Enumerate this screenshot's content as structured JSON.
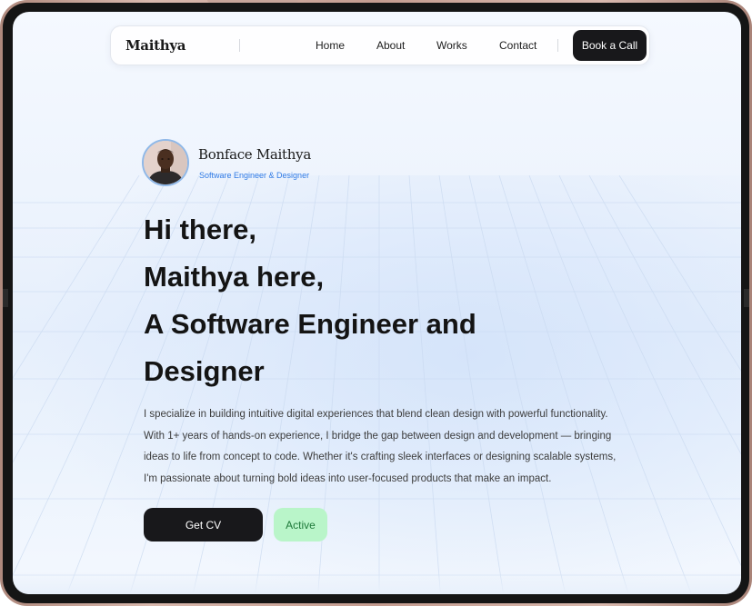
{
  "nav": {
    "brand": "Maithya",
    "links": [
      "Home",
      "About",
      "Works",
      "Contact"
    ],
    "cta_label": "Book a Call"
  },
  "profile": {
    "name": "Bonface Maithya",
    "role": "Software Engineer & Designer"
  },
  "hero": {
    "lines": [
      "Hi there,",
      "Maithya here,",
      "A Software Engineer and",
      "Designer"
    ],
    "paragraph": "I specialize in building intuitive digital experiences that blend clean design with powerful functionality. With 1+ years of hands-on experience, I bridge the gap between design and development — bringing ideas to life from concept to code. Whether it's crafting sleek interfaces or designing scalable systems, I'm passionate about turning bold ideas into user-focused products that make an impact.",
    "primary_button": "Get CV",
    "status": "Active"
  },
  "colors": {
    "accent": "#2f7ae5",
    "dark": "#18181b",
    "status_bg": "#b9f5c9",
    "status_text": "#1f7a3a"
  }
}
